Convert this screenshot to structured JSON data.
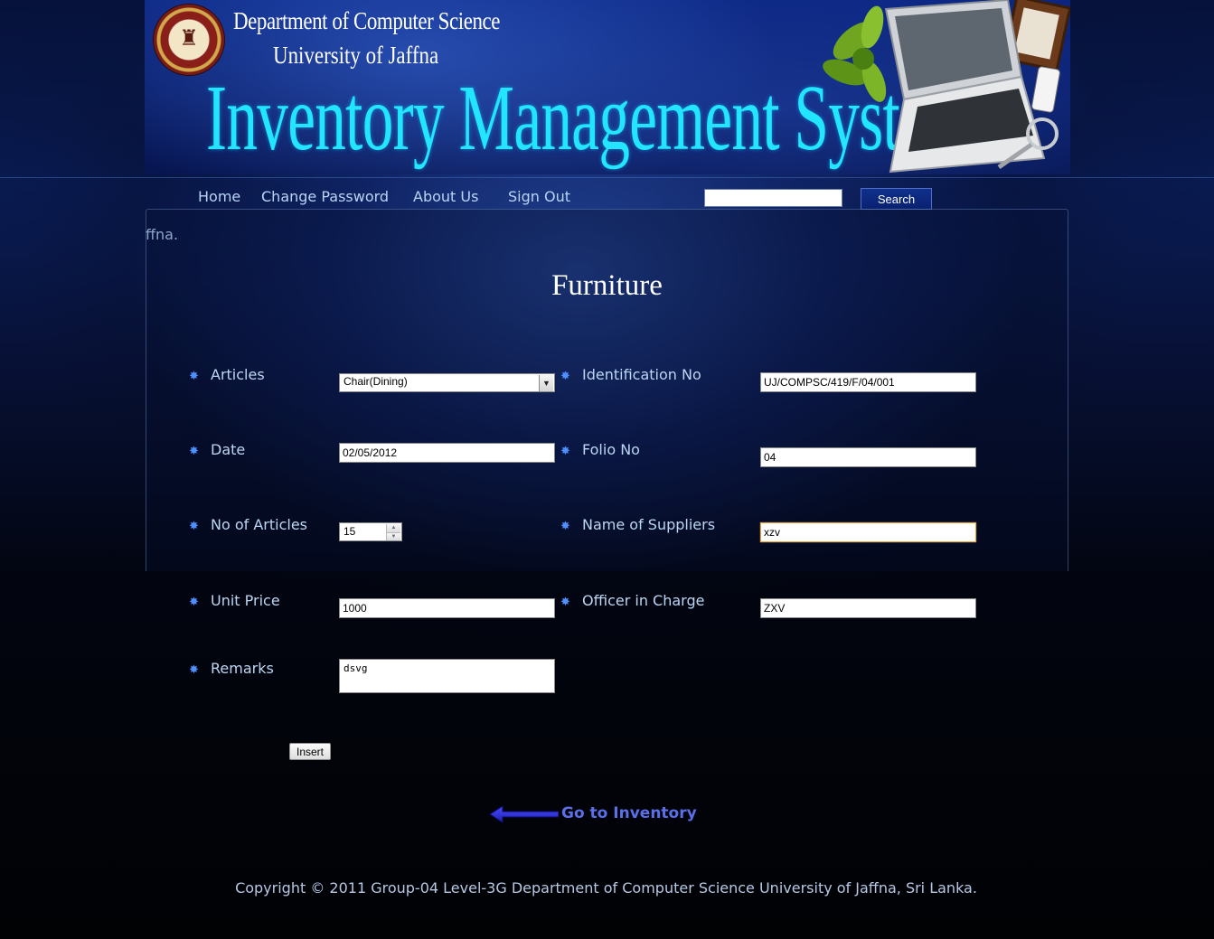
{
  "header": {
    "dept_line1": "Department of Computer Science",
    "dept_line2": "University of Jaffna",
    "system_title": "Inventory Management System"
  },
  "nav": {
    "items": [
      {
        "label": "Home"
      },
      {
        "label": "Change Password"
      },
      {
        "label": "About Us"
      },
      {
        "label": "Sign Out"
      }
    ],
    "search_value": "",
    "search_button": "Search"
  },
  "stray_text": "ffna.",
  "form": {
    "title": "Furniture",
    "articles": {
      "label": "Articles",
      "value": "Chair(Dining)"
    },
    "identification_no": {
      "label": "Identification No",
      "value": "UJ/COMPSC/419/F/04/001"
    },
    "date": {
      "label": "Date",
      "value": "02/05/2012"
    },
    "folio_no": {
      "label": "Folio No",
      "value": "04"
    },
    "no_of_articles": {
      "label": "No of Articles",
      "value": "15"
    },
    "name_of_suppliers": {
      "label": "Name of Suppliers",
      "value": "xzv"
    },
    "unit_price": {
      "label": "Unit Price",
      "value": "1000"
    },
    "officer_in_charge": {
      "label": "Officer in Charge",
      "value": "ZXV"
    },
    "remarks": {
      "label": "Remarks",
      "value": "dsvg"
    },
    "insert_button": "Insert"
  },
  "back_link": {
    "label": "Go to Inventory"
  },
  "footer": {
    "copyright": "Copyright © 2011 Group-04 Level-3G Department of Computer Science University of Jaffna, Sri Lanka."
  },
  "colors": {
    "title_cyan": "#22e6ff",
    "label_blue": "#bcd6f3",
    "bullet_blue": "#4f8fff",
    "link_blue": "#5a6fe8",
    "focus_orange": "#e5a34a"
  },
  "icons": {
    "bullet": "asterisk-bullet-icon",
    "back": "left-arrow-icon",
    "select": "chevron-down-icon",
    "seal": "university-seal-logo"
  }
}
